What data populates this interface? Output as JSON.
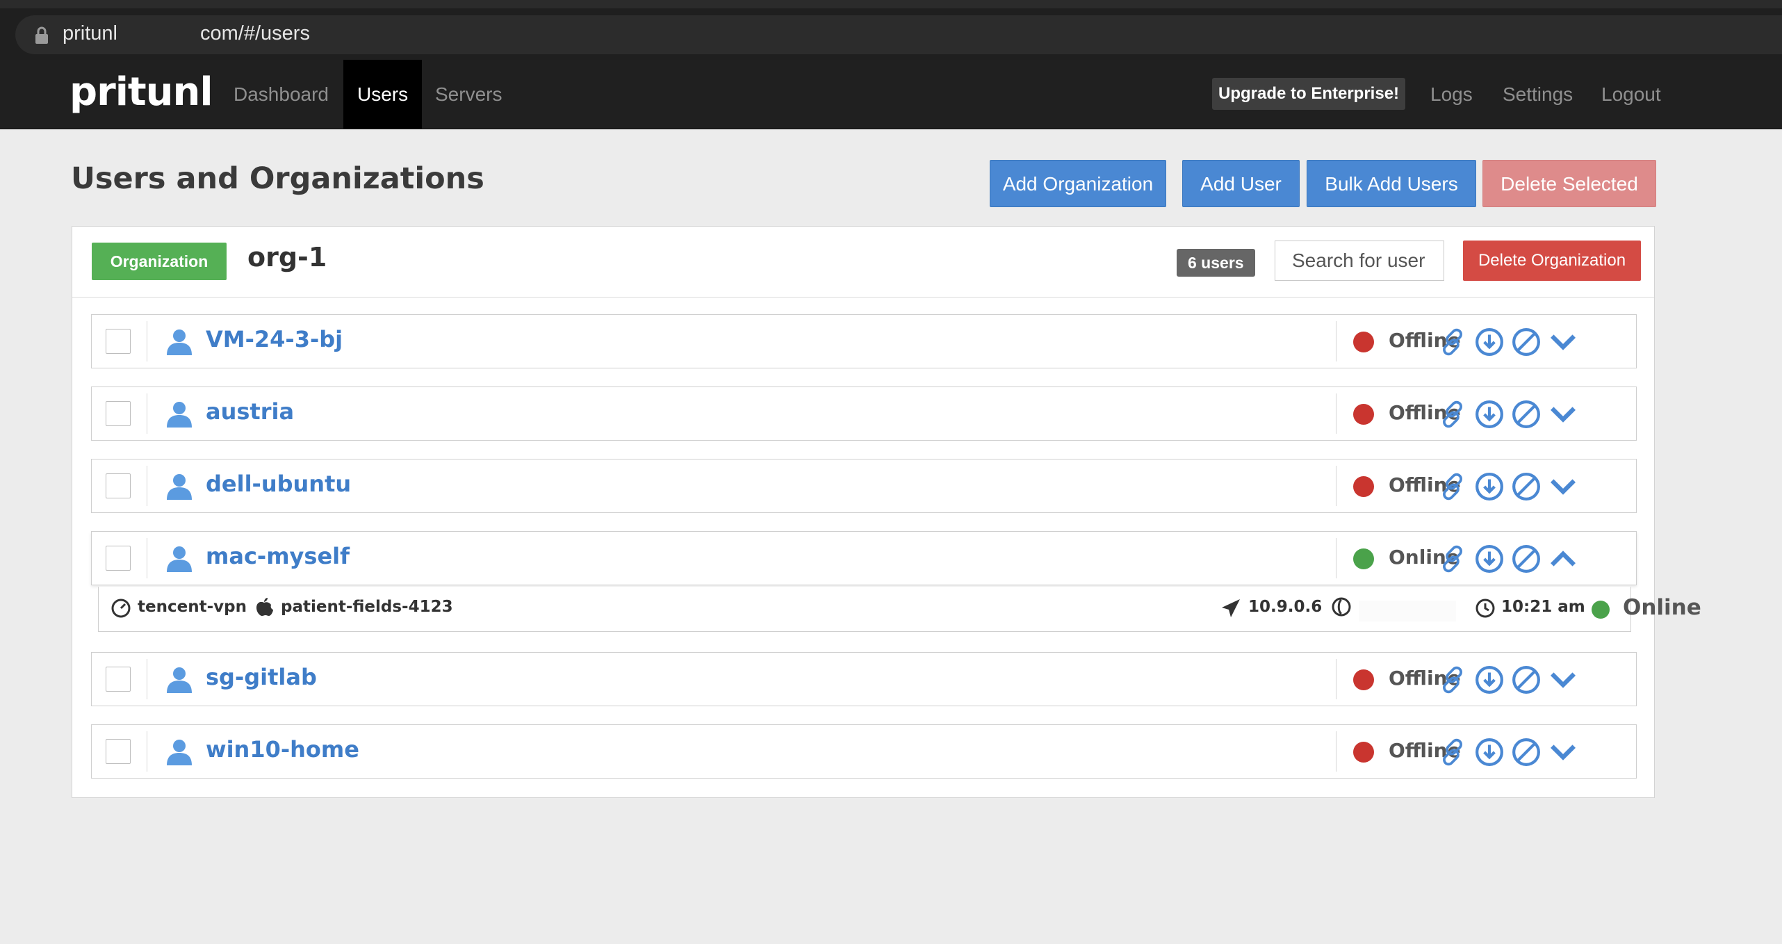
{
  "browser": {
    "url_prefix": "pritunl",
    "url_suffix": "com/#/users"
  },
  "nav": {
    "brand": "pritunl",
    "links": [
      "Dashboard",
      "Users",
      "Servers"
    ],
    "upgrade": "Upgrade to Enterprise!",
    "right_links": [
      "Logs",
      "Settings",
      "Logout"
    ]
  },
  "header": {
    "title": "Users and Organizations",
    "add_org": "Add Organization",
    "add_user": "Add User",
    "bulk_add": "Bulk Add Users",
    "delete_selected": "Delete Selected"
  },
  "org": {
    "label": "Organization",
    "name": "org-1",
    "count": "6 users",
    "search_placeholder": "Search for user",
    "delete": "Delete Organization"
  },
  "users": [
    {
      "name": "VM-24-3-bj",
      "status": "Offline"
    },
    {
      "name": "austria",
      "status": "Offline"
    },
    {
      "name": "dell-ubuntu",
      "status": "Offline"
    },
    {
      "name": "mac-myself",
      "status": "Online"
    },
    {
      "name": "sg-gitlab",
      "status": "Offline"
    },
    {
      "name": "win10-home",
      "status": "Offline"
    }
  ],
  "detail": {
    "server": "tencent-vpn",
    "device": "patient-fields-4123",
    "vpn_ip": "10.9.0.6",
    "time": "10:21 am",
    "status": "Online"
  },
  "colors": {
    "online": "#4aa24a",
    "offline": "#c9352f",
    "primary": "#4a88d3",
    "link": "#3f7dc8"
  }
}
